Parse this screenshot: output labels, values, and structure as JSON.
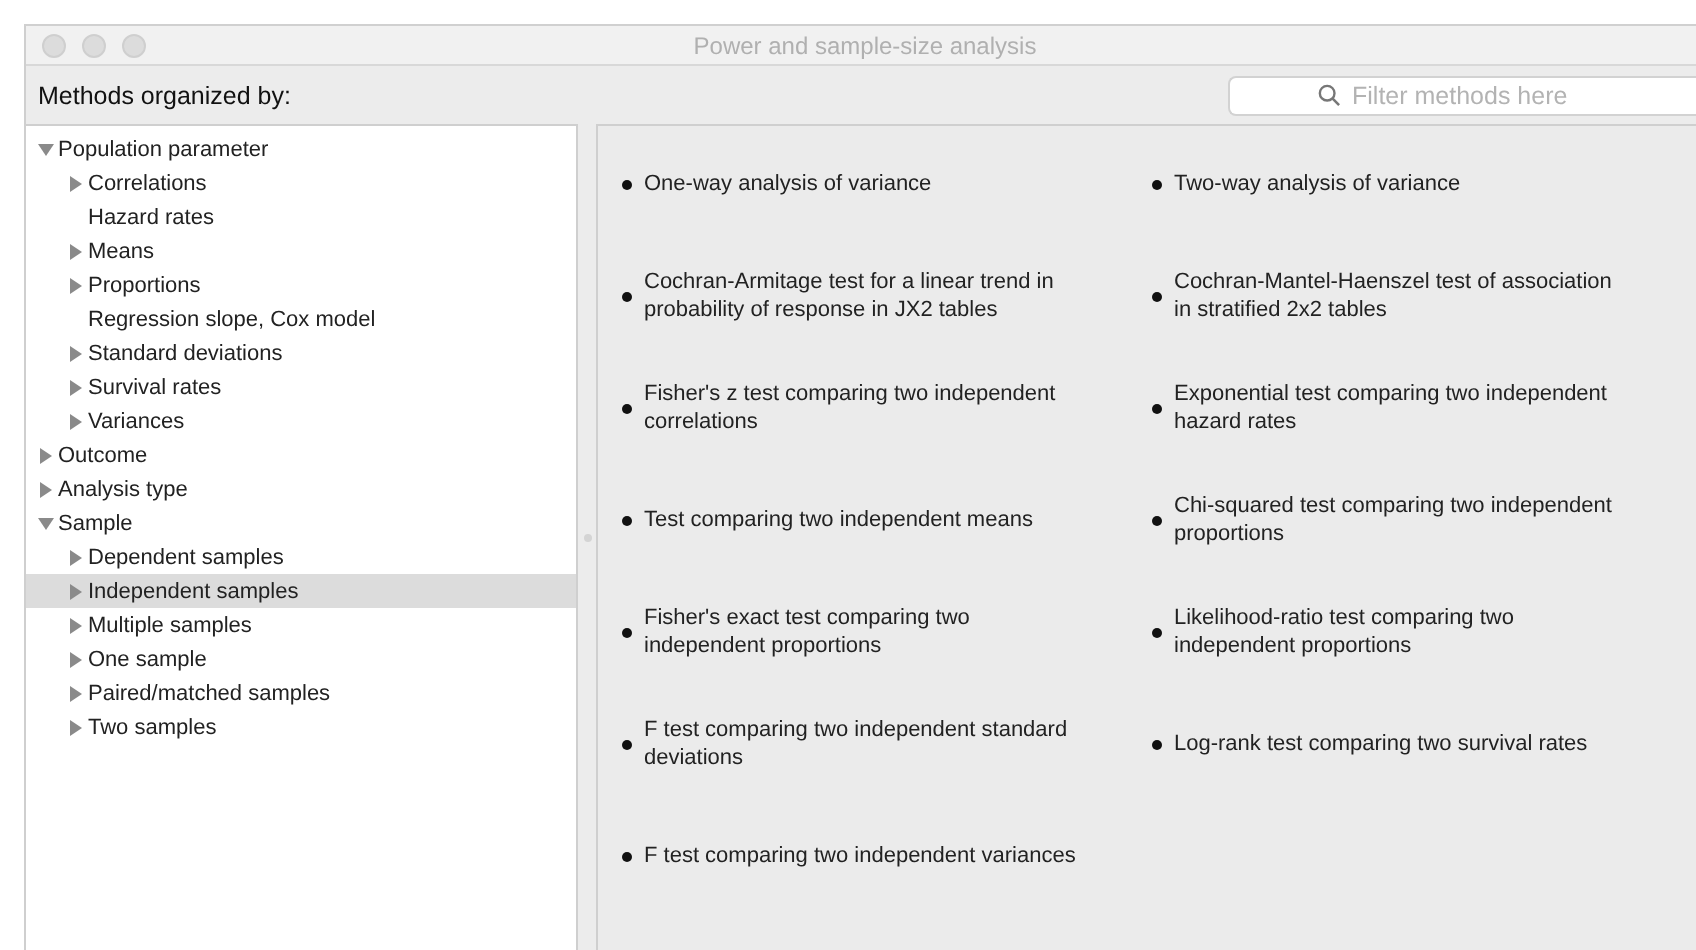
{
  "window": {
    "title": "Power and sample-size analysis"
  },
  "header": {
    "label": "Methods organized by:",
    "search": {
      "placeholder": "Filter methods here"
    }
  },
  "tree": [
    {
      "label": "Population parameter",
      "kind": "group",
      "expanded": true,
      "selected": false,
      "children": [
        {
          "label": "Correlations",
          "kind": "group",
          "expanded": false,
          "selected": false
        },
        {
          "label": "Hazard rates",
          "kind": "leaf",
          "selected": false
        },
        {
          "label": "Means",
          "kind": "group",
          "expanded": false,
          "selected": false
        },
        {
          "label": "Proportions",
          "kind": "group",
          "expanded": false,
          "selected": false
        },
        {
          "label": "Regression slope, Cox model",
          "kind": "leaf",
          "selected": false
        },
        {
          "label": "Standard deviations",
          "kind": "group",
          "expanded": false,
          "selected": false
        },
        {
          "label": "Survival rates",
          "kind": "group",
          "expanded": false,
          "selected": false
        },
        {
          "label": "Variances",
          "kind": "group",
          "expanded": false,
          "selected": false
        }
      ]
    },
    {
      "label": "Outcome",
      "kind": "group",
      "expanded": false,
      "selected": false
    },
    {
      "label": "Analysis type",
      "kind": "group",
      "expanded": false,
      "selected": false
    },
    {
      "label": "Sample",
      "kind": "group",
      "expanded": true,
      "selected": false,
      "children": [
        {
          "label": "Dependent samples",
          "kind": "group",
          "expanded": false,
          "selected": false
        },
        {
          "label": "Independent samples",
          "kind": "group",
          "expanded": false,
          "selected": true
        },
        {
          "label": "Multiple samples",
          "kind": "group",
          "expanded": false,
          "selected": false
        },
        {
          "label": "One sample",
          "kind": "group",
          "expanded": false,
          "selected": false
        },
        {
          "label": "Paired/matched samples",
          "kind": "group",
          "expanded": false,
          "selected": false
        },
        {
          "label": "Two samples",
          "kind": "group",
          "expanded": false,
          "selected": false
        }
      ]
    }
  ],
  "method_rows": [
    [
      "One-way analysis of variance",
      "Two-way analysis of variance"
    ],
    [
      "Cochran-Armitage test for a linear trend in probability of response in JX2 tables",
      "Cochran-Mantel-Haenszel test of association in stratified 2x2 tables"
    ],
    [
      "Fisher's z test comparing two independent correlations",
      "Exponential test comparing two independent hazard rates"
    ],
    [
      "Test comparing two independent means",
      "Chi-squared test comparing two independent proportions"
    ],
    [
      "Fisher's exact test comparing two independent proportions",
      "Likelihood-ratio test comparing two independent proportions"
    ],
    [
      "F test comparing two independent standard deviations",
      "Log-rank test comparing two survival rates"
    ],
    [
      "F test comparing two independent variances"
    ]
  ]
}
